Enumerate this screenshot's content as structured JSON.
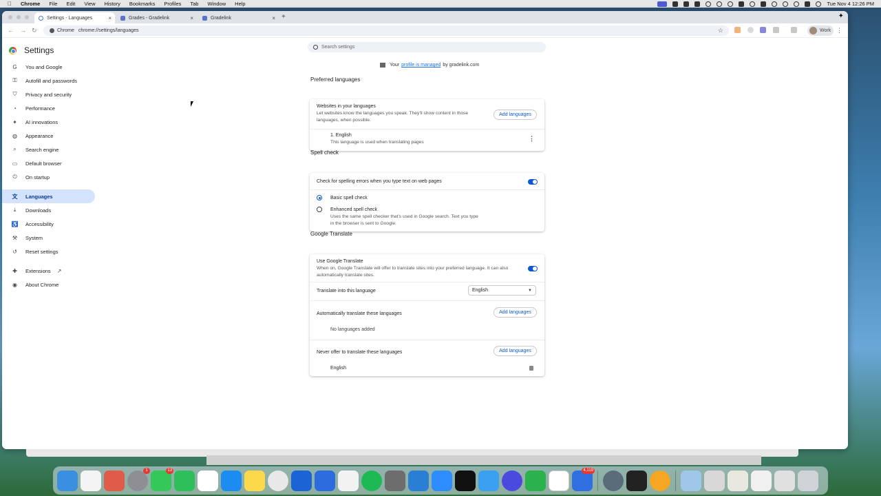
{
  "menubar": {
    "app_name": "Chrome",
    "items": [
      "File",
      "Edit",
      "View",
      "History",
      "Bookmarks",
      "Profiles",
      "Tab",
      "Window",
      "Help"
    ],
    "clock": "Tue Nov 4  12:26 PM"
  },
  "tabs": [
    {
      "title": "Settings - Languages",
      "active": true
    },
    {
      "title": "Grades - Gradelink",
      "active": false
    },
    {
      "title": "Gradelink",
      "active": false
    }
  ],
  "omnibox": {
    "chip": "Chrome",
    "url": "chrome://settings/languages"
  },
  "profile": {
    "label": "Work"
  },
  "settings": {
    "title": "Settings",
    "search_placeholder": "Search settings",
    "sidebar": [
      {
        "label": "You and Google",
        "icon": "google-icon"
      },
      {
        "label": "Autofill and passwords",
        "icon": "key-icon"
      },
      {
        "label": "Privacy and security",
        "icon": "shield-icon"
      },
      {
        "label": "Performance",
        "icon": "speedometer-icon"
      },
      {
        "label": "AI innovations",
        "icon": "sparkle-icon"
      },
      {
        "label": "Appearance",
        "icon": "palette-icon"
      },
      {
        "label": "Search engine",
        "icon": "search-icon"
      },
      {
        "label": "Default browser",
        "icon": "browser-icon"
      },
      {
        "label": "On startup",
        "icon": "power-icon"
      },
      {
        "label": "Languages",
        "icon": "translate-icon",
        "active": true
      },
      {
        "label": "Downloads",
        "icon": "download-icon"
      },
      {
        "label": "Accessibility",
        "icon": "accessibility-icon"
      },
      {
        "label": "System",
        "icon": "wrench-icon"
      },
      {
        "label": "Reset settings",
        "icon": "reset-icon"
      },
      {
        "label": "Extensions",
        "icon": "puzzle-icon"
      },
      {
        "label": "About Chrome",
        "icon": "chrome-icon"
      }
    ],
    "managed": {
      "prefix": "Your",
      "link": "profile is managed",
      "suffix": "by gradelink.com"
    },
    "preferred": {
      "section_title": "Preferred languages",
      "label": "Websites in your languages",
      "description_line1": "Let websites know the languages you speak. They'll show content in those",
      "description_line2": "languages, when possible.",
      "add_button": "Add languages",
      "language_name": "1. English",
      "language_note": "This language is used when translating pages"
    },
    "spell": {
      "section_title": "Spell check",
      "toggle_label": "Check for spelling errors when you type text on web pages",
      "toggle_on": true,
      "basic_label": "Basic spell check",
      "enhanced_label": "Enhanced spell check",
      "enhanced_desc_line1": "Uses the same spell checker that's used in Google search. Text you type",
      "enhanced_desc_line2": "in the browser is sent to Google.",
      "selected": "basic"
    },
    "translate": {
      "section_title": "Google Translate",
      "use_label": "Use Google Translate",
      "use_desc_line1": "When on, Google Translate will offer to translate sites into your preferred language. It can also",
      "use_desc_line2": "automatically translate sites.",
      "toggle_on": true,
      "target_label": "Translate into this language",
      "target_value": "English",
      "auto_label": "Automatically translate these languages",
      "auto_button": "Add languages",
      "auto_empty": "No languages added",
      "never_label": "Never offer to translate these languages",
      "never_button": "Add languages",
      "never_item": "English"
    }
  },
  "dock": {
    "badges": {
      "messages": "1",
      "facetime": "13",
      "d-app": "4,119"
    }
  },
  "colors": {
    "accent": "#0b57d0",
    "active_nav_bg": "#d3e3fd",
    "link": "#1a73e8"
  }
}
